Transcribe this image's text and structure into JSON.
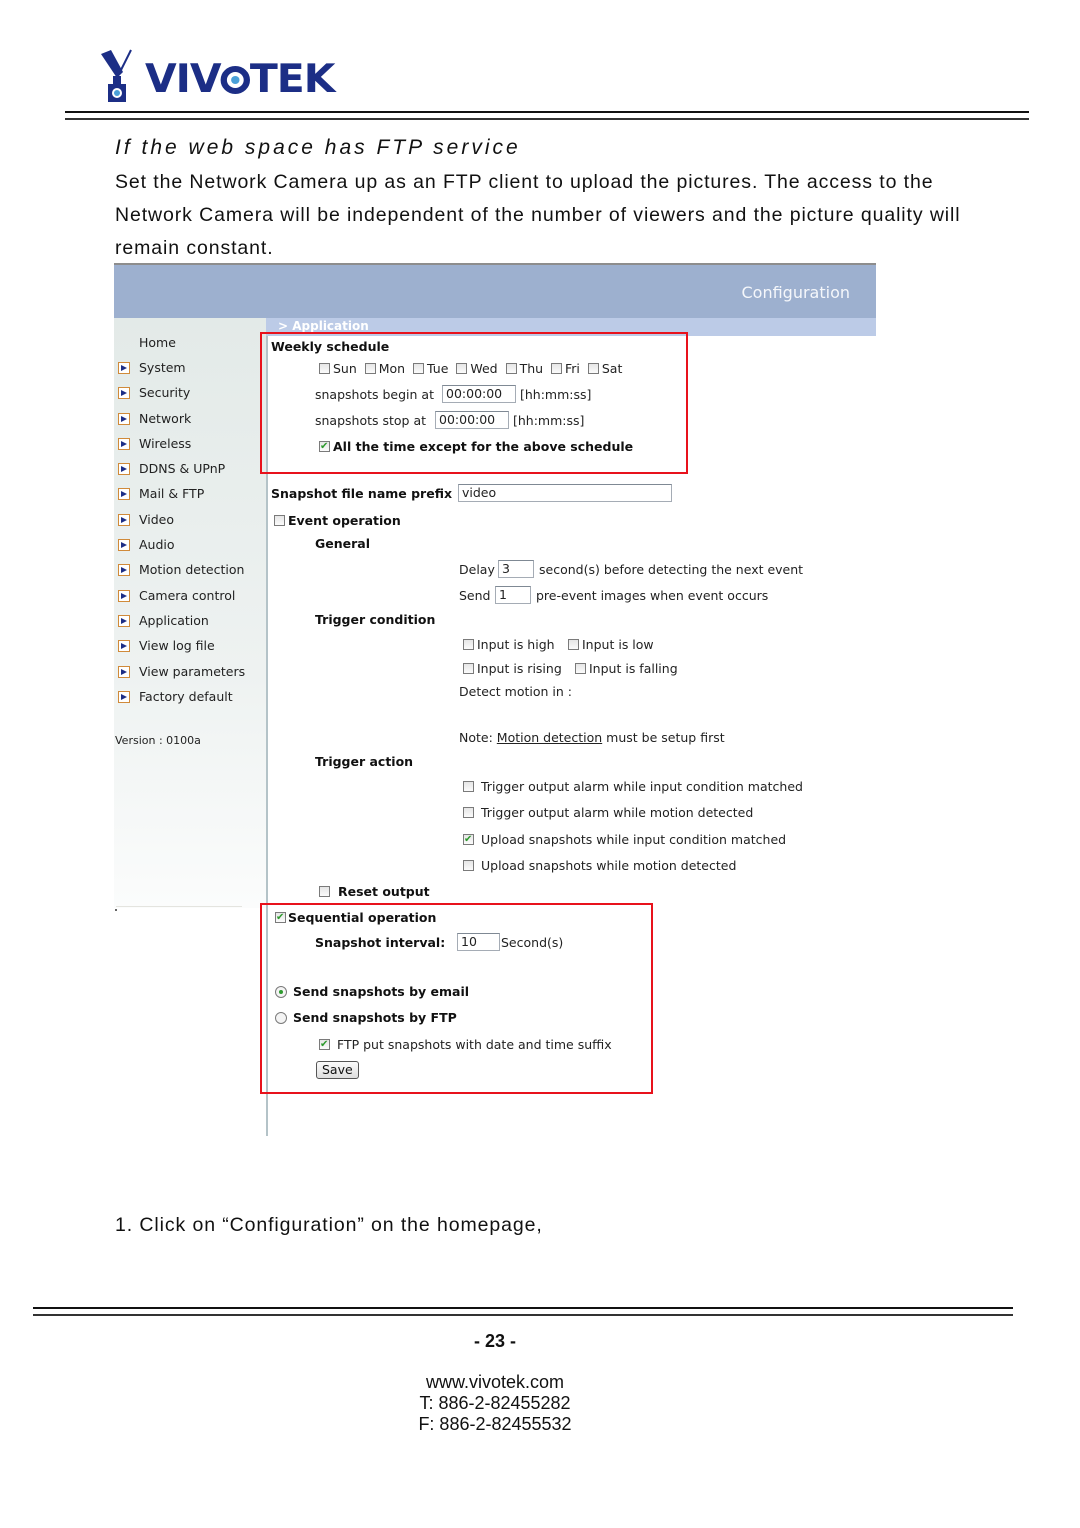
{
  "brand": {
    "name": "VIVOTEK",
    "logo_color": "#1c2e86"
  },
  "heading": "If the web space has FTP service",
  "paragraph": "Set the Network Camera up as an FTP client to upload the pictures. The access to the Network Camera will be independent of the number of viewers and the picture quality will remain constant.",
  "screenshot": {
    "config_link": "Configuration",
    "breadcrumb": "> Application",
    "sidebar": {
      "home": "Home",
      "items": [
        "System",
        "Security",
        "Network",
        "Wireless",
        "DDNS & UPnP",
        "Mail & FTP",
        "Video",
        "Audio",
        "Motion detection",
        "Camera control",
        "Application",
        "View log file",
        "View parameters",
        "Factory default"
      ],
      "version": "Version : 0100a"
    },
    "weekly_schedule": {
      "title": "Weekly schedule",
      "days": [
        {
          "label": "Sun",
          "checked": false
        },
        {
          "label": "Mon",
          "checked": false
        },
        {
          "label": "Tue",
          "checked": false
        },
        {
          "label": "Wed",
          "checked": false
        },
        {
          "label": "Thu",
          "checked": false
        },
        {
          "label": "Fri",
          "checked": false
        },
        {
          "label": "Sat",
          "checked": false
        }
      ],
      "begin_label": "snapshots begin at",
      "begin_value": "00:00:00",
      "stop_label": "snapshots stop at",
      "stop_value": "00:00:00",
      "time_format": "[hh:mm:ss]",
      "except_label": "All the time except for the above schedule",
      "except_checked": true
    },
    "prefix": {
      "label": "Snapshot file name prefix",
      "value": "video"
    },
    "event": {
      "label": "Event operation",
      "checked": false,
      "general": "General",
      "delay_label": "Delay",
      "delay_value": "3",
      "delay_suffix": "second(s) before detecting the next event",
      "send_label": "Send",
      "send_value": "1",
      "send_suffix": "pre-event images when event occurs",
      "trigger_condition": "Trigger condition",
      "conditions": [
        {
          "label": "Input is high",
          "checked": false
        },
        {
          "label": "Input is low",
          "checked": false
        },
        {
          "label": "Input is rising",
          "checked": false
        },
        {
          "label": "Input is falling",
          "checked": false
        }
      ],
      "detect_motion": "Detect motion in :",
      "note_prefix": "Note:",
      "note_link": "Motion detection",
      "note_suffix": "must be setup first",
      "trigger_action": "Trigger action",
      "actions": [
        {
          "label": "Trigger output alarm while input condition matched",
          "checked": false
        },
        {
          "label": "Trigger output alarm while motion detected",
          "checked": false
        },
        {
          "label": "Upload snapshots while input condition matched",
          "checked": true
        },
        {
          "label": "Upload snapshots while motion detected",
          "checked": false
        }
      ],
      "reset_output": "Reset output",
      "reset_checked": false
    },
    "sequential": {
      "label": "Sequential operation",
      "checked": true,
      "interval_label": "Snapshot interval:",
      "interval_value": "10",
      "interval_unit": "Second(s)"
    },
    "send_by_email": {
      "label": "Send snapshots by email",
      "selected": true
    },
    "send_by_ftp": {
      "label": "Send snapshots by FTP",
      "selected": false
    },
    "ftp_suffix": {
      "label": "FTP put snapshots with date and time suffix",
      "checked": true
    },
    "save": "Save"
  },
  "step": "1. Click on “Configuration” on the homepage,",
  "footer": {
    "page": "- 23 -",
    "website": "www.vivotek.com",
    "phone": "T: 886-2-82455282",
    "fax": "F: 886-2-82455532"
  }
}
